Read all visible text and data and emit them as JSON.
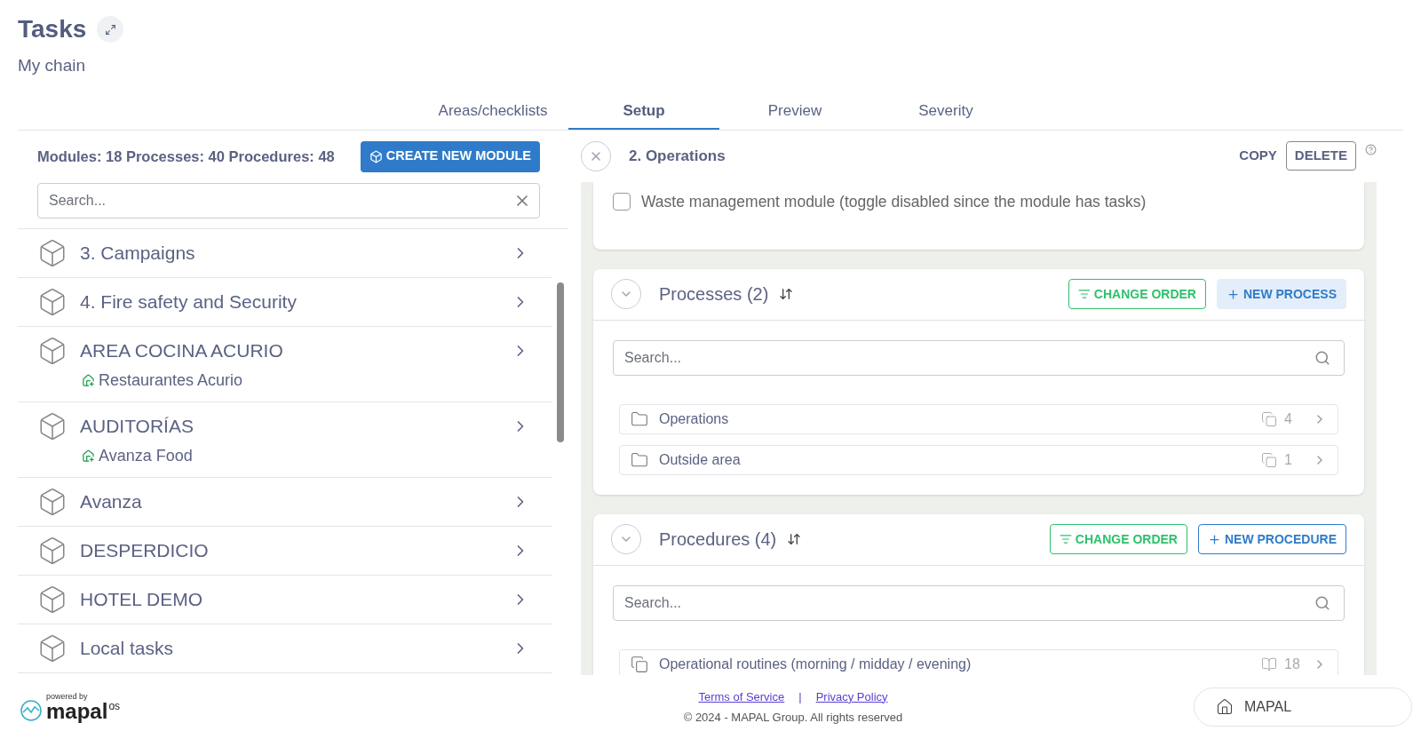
{
  "header": {
    "title": "Tasks",
    "subtitle": "My chain"
  },
  "tabs": [
    {
      "label": "Areas/checklists",
      "selected": false
    },
    {
      "label": "Setup",
      "selected": true
    },
    {
      "label": "Preview",
      "selected": false
    },
    {
      "label": "Severity",
      "selected": false
    }
  ],
  "modules_panel": {
    "stats": "Modules: 18 Processes: 40 Procedures: 48",
    "create_button": "CREATE NEW MODULE",
    "search": {
      "placeholder": "Search..."
    },
    "items": [
      {
        "name": "3. Campaigns"
      },
      {
        "name": "4. Fire safety and Security"
      },
      {
        "name": "AREA COCINA ACURIO",
        "location": "Restaurantes Acurio"
      },
      {
        "name": "AUDITORÍAS",
        "location": "Avanza Food"
      },
      {
        "name": "Avanza"
      },
      {
        "name": "DESPERDICIO"
      },
      {
        "name": "HOTEL DEMO"
      },
      {
        "name": "Local tasks"
      }
    ]
  },
  "detail": {
    "title": "2. Operations",
    "copy": "COPY",
    "delete": "DELETE",
    "waste_checkbox": {
      "label": "Waste management module (toggle disabled since the module has tasks)",
      "checked": false
    },
    "sections": [
      {
        "kind": "processes",
        "title": "Processes (2)",
        "change_order": "CHANGE ORDER",
        "new_button": "NEW PROCESS",
        "search": {
          "placeholder": "Search..."
        },
        "items": [
          {
            "name": "Operations",
            "count": "4"
          },
          {
            "name": "Outside area",
            "count": "1"
          }
        ]
      },
      {
        "kind": "procedures",
        "title": "Procedures (4)",
        "change_order": "CHANGE ORDER",
        "new_button": "NEW PROCEDURE",
        "search": {
          "placeholder": "Search..."
        },
        "items": [
          {
            "name": "Operational routines (morning / midday / evening)",
            "count": "18"
          }
        ]
      }
    ]
  },
  "footer": {
    "powered_by": "powered by",
    "logo": "mapal",
    "logo_suffix": "os",
    "links": [
      "Terms of Service",
      "Privacy Policy"
    ],
    "separator": "|",
    "copyright": "© 2024 - MAPAL Group. All rights reserved",
    "mapal_button": "MAPAL"
  }
}
